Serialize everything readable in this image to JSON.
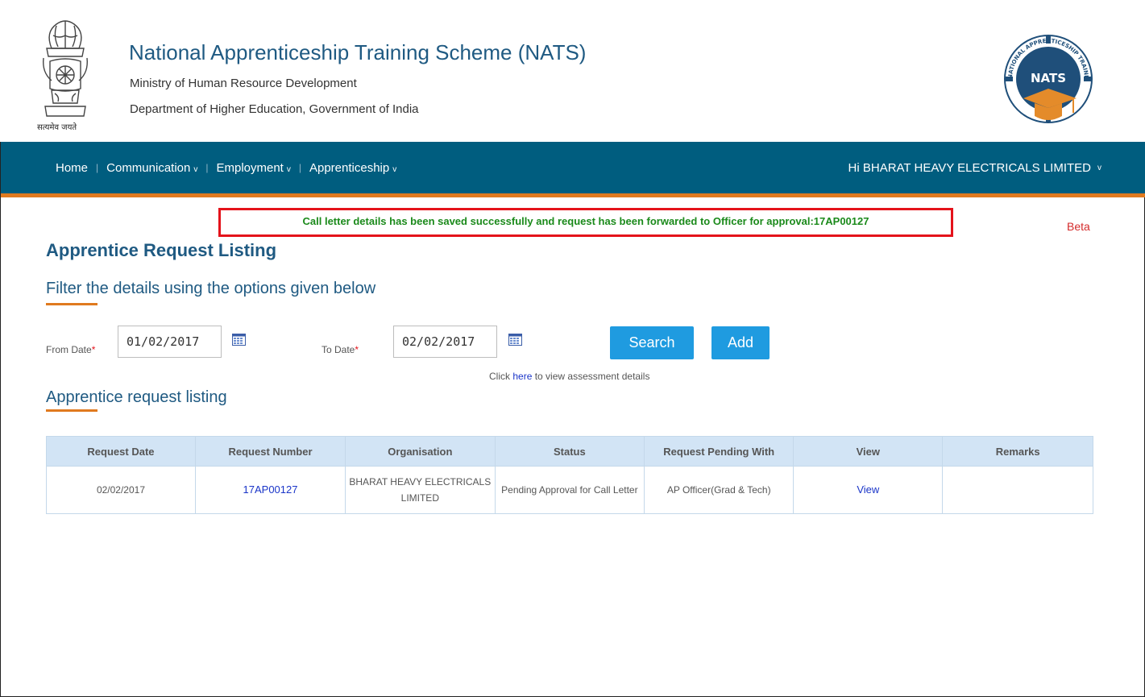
{
  "header": {
    "title": "National Apprenticeship Training Scheme (NATS)",
    "ministry": "Ministry of Human Resource Development",
    "department": "Department of Higher Education, Government of India",
    "emblem_motto": "सत्यमेव जयते",
    "logo_text": "NATS",
    "logo_ring_text": "NATIONAL APPRENTICESHIP TRAINING SCHEME"
  },
  "nav": {
    "items": [
      {
        "label": "Home"
      },
      {
        "label": "Communication"
      },
      {
        "label": "Employment"
      },
      {
        "label": "Apprenticeship"
      }
    ],
    "caret": "v",
    "separator": "|",
    "user_greeting": "Hi BHARAT HEAVY ELECTRICALS LIMITED"
  },
  "message": "Call letter details has been saved successfully and request has been forwarded to Officer for approval:17AP00127",
  "beta": "Beta",
  "page_title": "Apprentice Request Listing",
  "filter_title": "Filter the details using the options given below",
  "form": {
    "from_label": "From Date",
    "from_value": "01/02/2017",
    "to_label": "To Date",
    "to_value": "02/02/2017",
    "required_mark": "*",
    "search_label": "Search",
    "add_label": "Add",
    "hint_prefix": "Click ",
    "hint_link": "here",
    "hint_suffix": " to view assessment details"
  },
  "list_title": "Apprentice request listing",
  "table": {
    "headers": [
      "Request Date",
      "Request Number",
      "Organisation",
      "Status",
      "Request Pending With",
      "View",
      "Remarks"
    ],
    "rows": [
      {
        "request_date": "02/02/2017",
        "request_number": "17AP00127",
        "organisation": "BHARAT HEAVY ELECTRICALS LIMITED",
        "status": "Pending Approval for Call Letter",
        "pending_with": "AP Officer(Grad & Tech)",
        "view": "View",
        "remarks": ""
      }
    ]
  },
  "colors": {
    "nav_bg": "#005d7f",
    "nav_accent": "#e07a1f",
    "title_blue": "#1f5a82",
    "button_blue": "#1f9be0",
    "success_green": "#1b8a1b",
    "alert_red": "#e4131b",
    "table_header_bg": "#d2e4f5"
  }
}
